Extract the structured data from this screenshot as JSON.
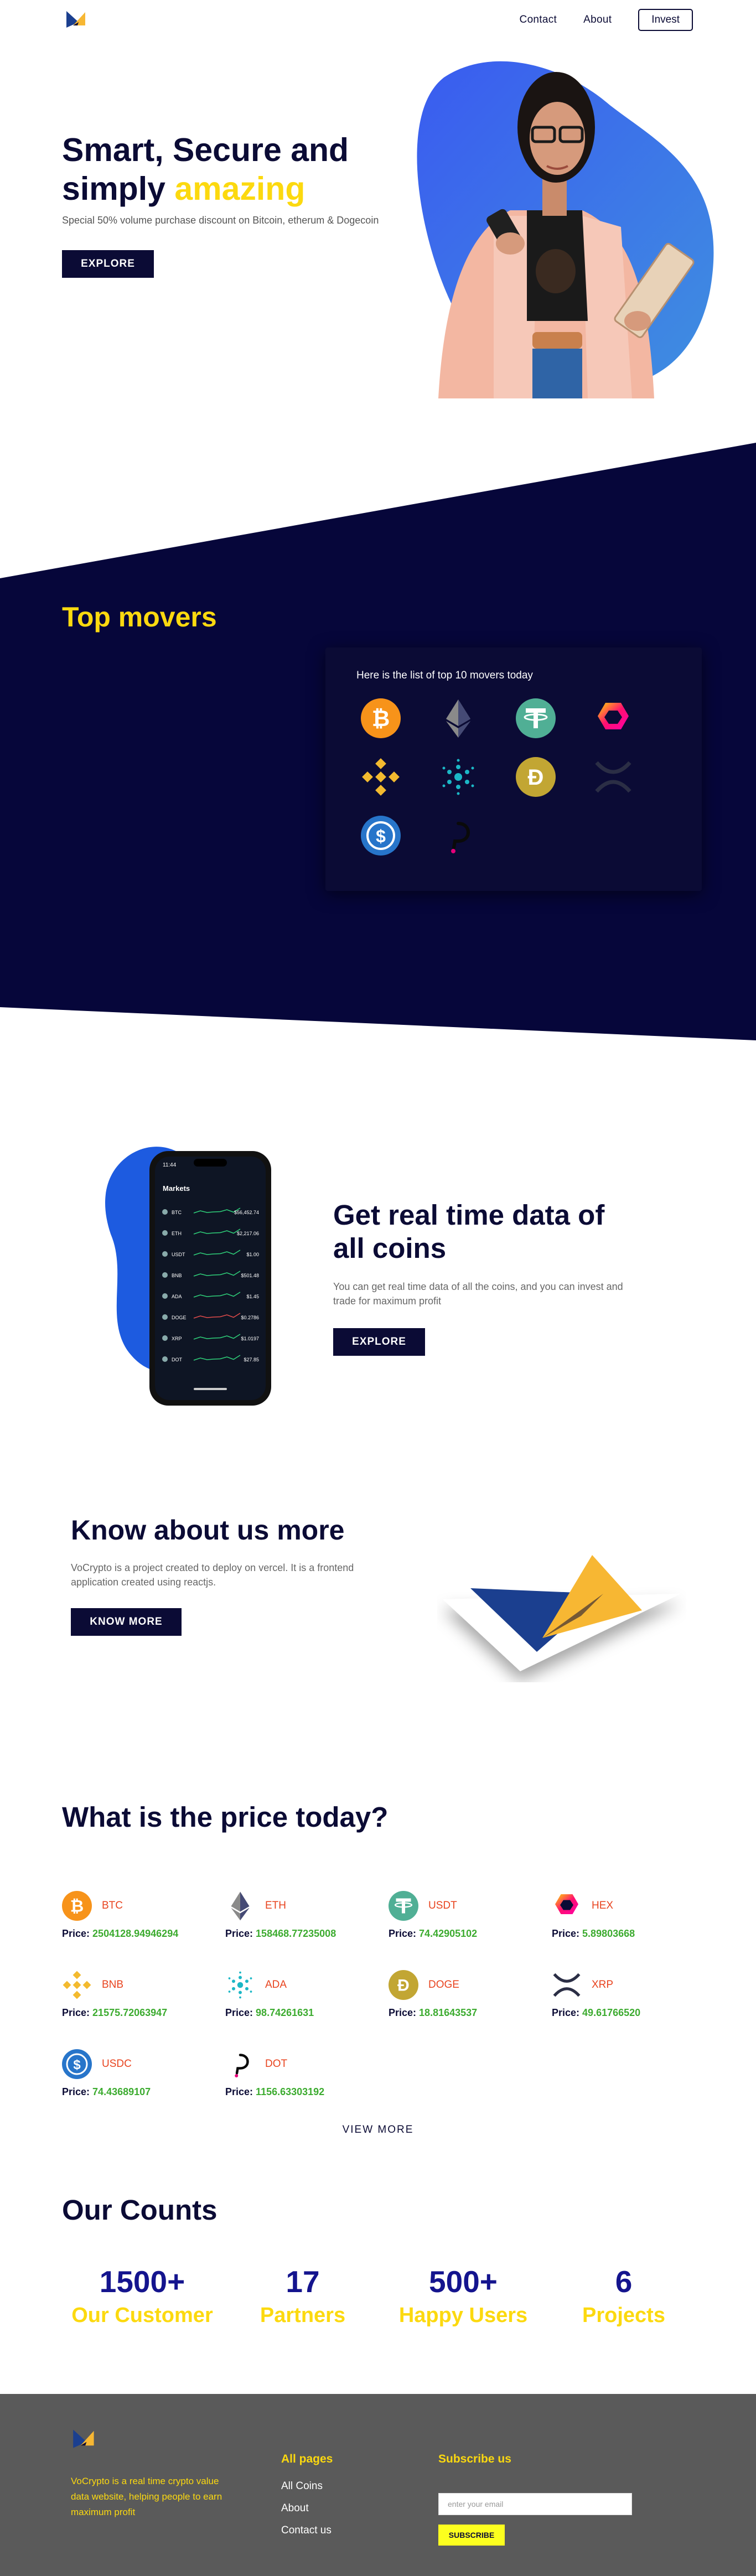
{
  "nav": {
    "logo_icon": "brand-logo",
    "links": [
      "Contact",
      "About"
    ],
    "invest_label": "Invest"
  },
  "hero": {
    "title_line1": "Smart, Secure and",
    "title_line2_prefix": "simply ",
    "title_accent": "amazing",
    "subtitle": "Special 50% volume purchase discount on Bitcoin, etherum & Dogecoin",
    "button": "EXPLORE",
    "image": "woman-holding-phone-and-book"
  },
  "movers": {
    "title": "Top movers",
    "card_title": "Here is the list of top 10 movers today",
    "coins": [
      "bitcoin-icon",
      "ethereum-icon",
      "tether-icon",
      "hex-icon",
      "binance-icon",
      "cardano-icon",
      "dogecoin-icon",
      "xrp-icon",
      "usdc-icon",
      "polkadot-icon"
    ]
  },
  "realtime": {
    "title": "Get real time data of all coins",
    "subtitle": "You can get real time data of all the coins, and you can invest and trade for maximum profit",
    "button": "EXPLORE",
    "phone_header": "Markets",
    "phone_time": "11:44",
    "phone_rows": [
      {
        "sym": "BTC",
        "val": "$56,452.74"
      },
      {
        "sym": "ETH",
        "val": "$2,217.06"
      },
      {
        "sym": "USDT",
        "val": "$1.00"
      },
      {
        "sym": "BNB",
        "val": "$501.48"
      },
      {
        "sym": "ADA",
        "val": "$1.45"
      },
      {
        "sym": "DOGE",
        "val": "$0.2786"
      },
      {
        "sym": "XRP",
        "val": "$1.0197"
      },
      {
        "sym": "DOT",
        "val": "$27.85"
      }
    ]
  },
  "about": {
    "title": "Know about us more",
    "subtitle": "VoCrypto is a project created to deploy on vercel. It is a frontend application created using reactjs.",
    "button": "KNOW MORE"
  },
  "prices": {
    "title": "What is the price today?",
    "price_label": "Price:",
    "items": [
      {
        "symbol": "BTC",
        "price": "2504128.94946294",
        "icon": "bitcoin-icon"
      },
      {
        "symbol": "ETH",
        "price": "158468.77235008",
        "icon": "ethereum-icon"
      },
      {
        "symbol": "USDT",
        "price": "74.42905102",
        "icon": "tether-icon"
      },
      {
        "symbol": "HEX",
        "price": "5.89803668",
        "icon": "hex-icon"
      },
      {
        "symbol": "BNB",
        "price": "21575.72063947",
        "icon": "binance-icon"
      },
      {
        "symbol": "ADA",
        "price": "98.74261631",
        "icon": "cardano-icon"
      },
      {
        "symbol": "DOGE",
        "price": "18.81643537",
        "icon": "dogecoin-icon"
      },
      {
        "symbol": "XRP",
        "price": "49.61766520",
        "icon": "xrp-icon"
      },
      {
        "symbol": "USDC",
        "price": "74.43689107",
        "icon": "usdc-icon"
      },
      {
        "symbol": "DOT",
        "price": "1156.63303192",
        "icon": "polkadot-icon"
      }
    ],
    "view_more": "VIEW MORE"
  },
  "counts": {
    "title": "Our Counts",
    "items": [
      {
        "num": "1500+",
        "label": "Our Customer"
      },
      {
        "num": "17",
        "label": "Partners"
      },
      {
        "num": "500+",
        "label": "Happy Users"
      },
      {
        "num": "6",
        "label": "Projects"
      }
    ]
  },
  "footer": {
    "description": "VoCrypto is a real time crypto value data website, helping people to earn maximum profit",
    "pages_title": "All pages",
    "pages": [
      "All Coins",
      "About",
      "Contact us"
    ],
    "subscribe_title": "Subscribe us",
    "email_placeholder": "enter your email",
    "subscribe_button": "SUBSCRIBE"
  },
  "colors": {
    "navy": "#0b0b35",
    "yellow": "#fcd90f",
    "count_blue": "#14148e",
    "price_green": "#3cab2f",
    "symbol_red": "#e8431e",
    "footer_gray": "#5a5a5a"
  }
}
